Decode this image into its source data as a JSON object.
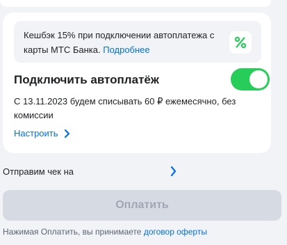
{
  "cashback": {
    "text": "Кешбэк 15% при подключении автоплатежа с карты МТС Банка.",
    "link": "Подробнее",
    "icon": "percent-icon"
  },
  "autopay": {
    "title": "Подключить автоплатёж",
    "enabled": true,
    "description": "С 13.11.2023 будем списывать 60 ₽ ежемесячно, без комиссии",
    "configure_label": "Настроить"
  },
  "receipt": {
    "label": "Отправим чек на"
  },
  "pay_button": {
    "label": "Оплатить"
  },
  "terms": {
    "text": "Нажимая Оплатить, вы принимаете",
    "link": "договор оферты"
  },
  "colors": {
    "accent": "#0070E5",
    "toggle_on": "#26CD58",
    "button_disabled_bg": "#D6DBE3",
    "button_disabled_text": "#9FA7B5",
    "background": "#F2F3F7"
  }
}
